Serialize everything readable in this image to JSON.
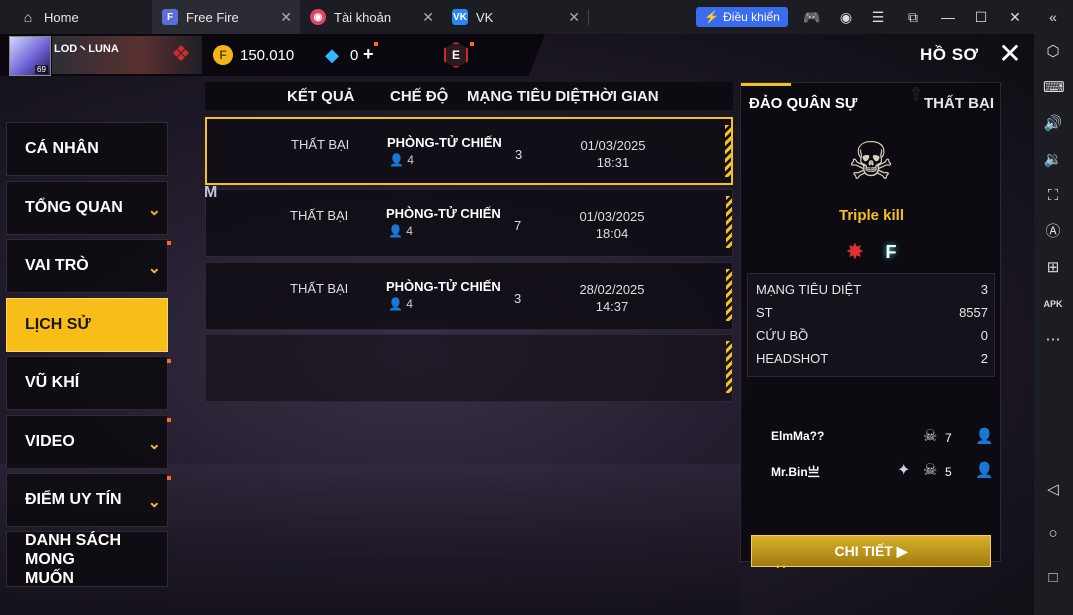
{
  "emulator": {
    "tabs": [
      {
        "label": "Home",
        "icon": "home-icon"
      },
      {
        "label": "Free Fire",
        "icon": "free-fire-app-icon"
      },
      {
        "label": "Tài khoản",
        "icon": "account-app-icon"
      },
      {
        "label": "VK",
        "icon": "vk-app-icon"
      }
    ],
    "control_button": "Điều khiển",
    "accent": "#3a6cf0"
  },
  "profile": {
    "name": "LOD丶LUNA",
    "level": "69",
    "gold": "150.010",
    "diamonds": "0",
    "page_title": "HỒ SƠ"
  },
  "menu": {
    "items": [
      {
        "label": "CÁ NHÂN",
        "chevron": false,
        "notif": false
      },
      {
        "label": "TỔNG QUAN",
        "chevron": true,
        "notif": false
      },
      {
        "label": "VAI TRÒ",
        "chevron": true,
        "notif": true
      },
      {
        "label": "LỊCH SỬ",
        "chevron": false,
        "notif": false,
        "active": true
      },
      {
        "label": "VŨ KHÍ",
        "chevron": false,
        "notif": true
      },
      {
        "label": "VIDEO",
        "chevron": true,
        "notif": true
      },
      {
        "label": "ĐIỂM UY TÍN",
        "chevron": true,
        "notif": true
      },
      {
        "label": "DANH SÁCH MONG MUỐN",
        "chevron": false,
        "notif": false
      }
    ]
  },
  "history": {
    "headers": {
      "result": "KẾT QUẢ",
      "mode": "CHẾ ĐỘ",
      "kills": "MẠNG TIÊU DIỆT",
      "time": "THỜI GIAN"
    },
    "rows": [
      {
        "result": "THẤT BẠI",
        "mode": "PHÒNG-TỬ CHIẾN",
        "players": "4",
        "kills": "3",
        "date": "01/03/2025",
        "time": "18:31"
      },
      {
        "result": "THẤT BẠI",
        "mode": "PHÒNG-TỬ CHIẾN",
        "players": "4",
        "kills": "7",
        "date": "01/03/2025",
        "time": "18:04"
      },
      {
        "result": "THẤT BẠI",
        "mode": "PHÒNG-TỬ CHIẾN",
        "players": "4",
        "kills": "3",
        "date": "28/02/2025",
        "time": "14:37"
      }
    ]
  },
  "detail": {
    "map": "ĐẢO QUÂN SỰ",
    "result": "THẤT BẠI",
    "achievement": "Triple kill",
    "stats": [
      {
        "label": "MẠNG TIÊU DIỆT",
        "value": "3"
      },
      {
        "label": "ST",
        "value": "8557"
      },
      {
        "label": "CỨU BỒ",
        "value": "0"
      },
      {
        "label": "HEADSHOT",
        "value": "2"
      }
    ],
    "teammates": [
      {
        "name": "ElmMa??",
        "kills": "7"
      },
      {
        "name": "Mr.Bin亗",
        "kills": "5"
      }
    ],
    "button": "CHI TIẾT ▶"
  }
}
